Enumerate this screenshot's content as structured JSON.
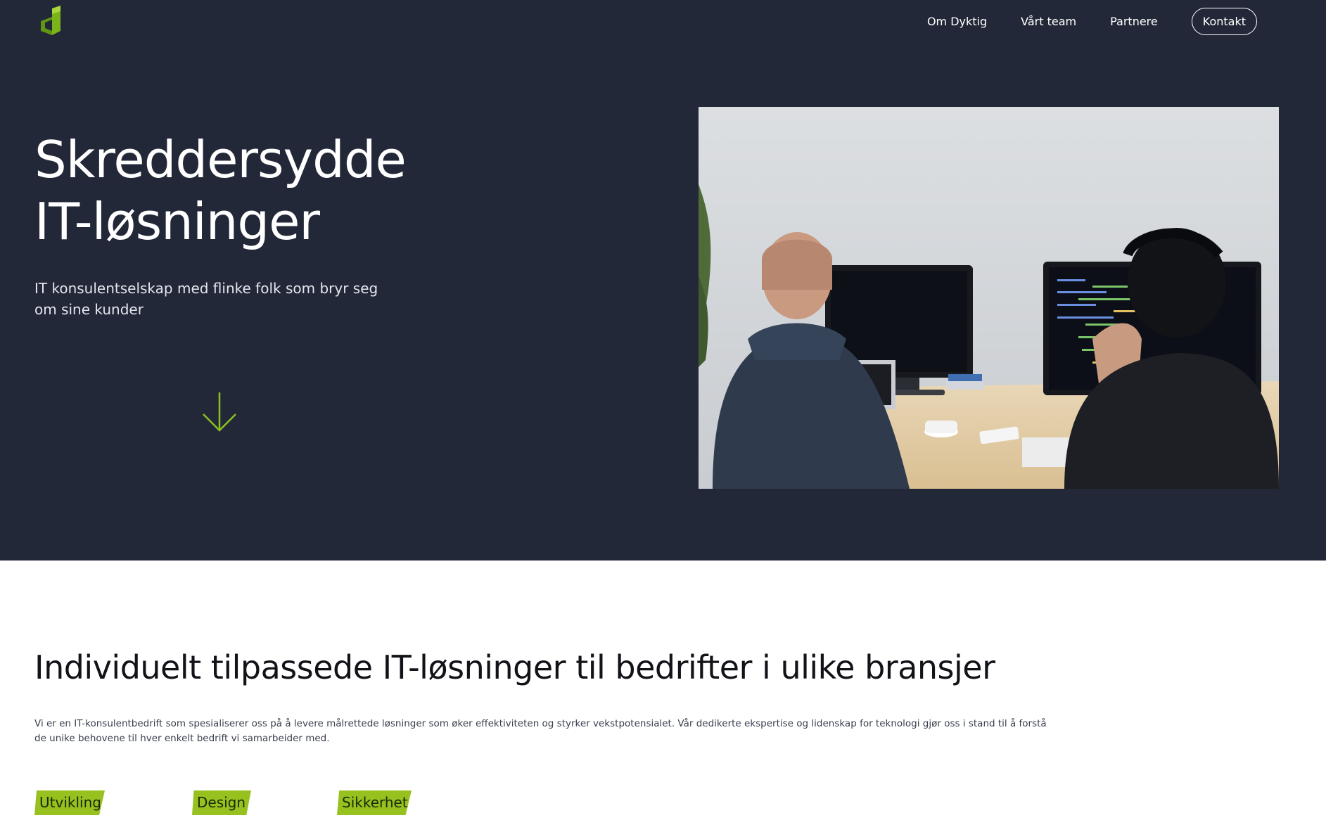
{
  "nav": {
    "links": [
      "Om Dyktig",
      "Vårt team",
      "Partnere"
    ],
    "cta": "Kontakt"
  },
  "hero": {
    "title_line1": "Skreddersydde",
    "title_line2": "IT-løsninger",
    "subtitle": "IT konsulentselskap med flinke folk som bryr seg om sine kunder"
  },
  "section": {
    "title": "Individuelt tilpassede IT-løsninger til bedrifter i ulike bransjer",
    "body": "Vi er en IT-konsulentbedrift som spesialiserer oss på å levere målrettede løsninger som øker effektiviteten og styrker vekstpotensialet. Vår dedikerte ekspertise og lidenskap for teknologi gjør oss i stand til å forstå de unike behovene til hver enkelt bedrift vi samarbeider med.",
    "tags": [
      "Utvikling",
      "Design",
      "Sikkerhet"
    ]
  },
  "colors": {
    "hero_bg": "#232839",
    "accent": "#96c11f"
  },
  "icons": {
    "logo": "dyktig-logo-icon",
    "scroll": "arrow-down-icon"
  }
}
